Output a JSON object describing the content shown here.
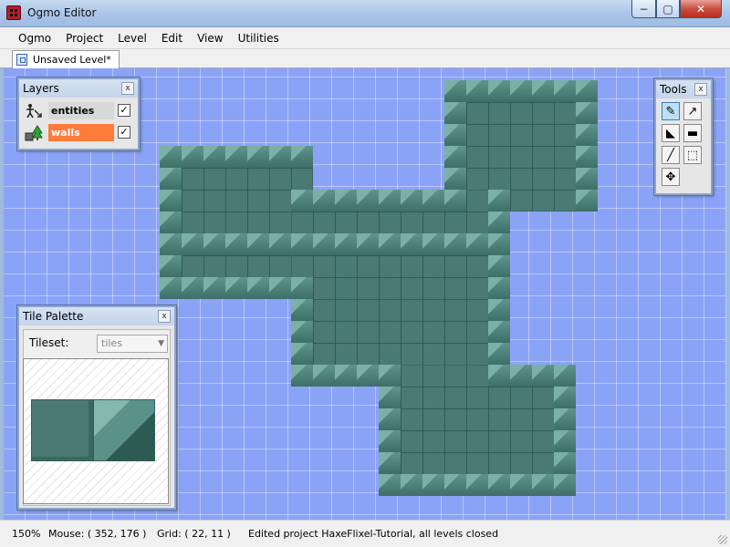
{
  "window": {
    "title": "Ogmo Editor",
    "minimize": "−",
    "maximize": "▢",
    "close": "✕"
  },
  "menu": {
    "items": [
      "Ogmo",
      "Project",
      "Level",
      "Edit",
      "View",
      "Utilities"
    ]
  },
  "tabs": [
    {
      "label": "Unsaved Level*"
    }
  ],
  "layers_panel": {
    "title": "Layers",
    "close": "x",
    "layers": [
      {
        "label": "entities",
        "checked": "✓",
        "icon": "entity-layer-icon",
        "highlight": "#d8d8d8"
      },
      {
        "label": "walls",
        "checked": "✓",
        "icon": "tile-layer-icon",
        "highlight": "#ff7b3a"
      }
    ]
  },
  "tools_panel": {
    "title": "Tools",
    "close": "x",
    "tools": [
      {
        "icon": "pencil-icon",
        "glyph": "✎",
        "active": true
      },
      {
        "icon": "eyedropper-icon",
        "glyph": "↗",
        "active": false
      },
      {
        "icon": "flood-fill-icon",
        "glyph": "◣",
        "active": false
      },
      {
        "icon": "rectangle-fill-icon",
        "glyph": "▬",
        "active": false
      },
      {
        "icon": "line-icon",
        "glyph": "╱",
        "active": false
      },
      {
        "icon": "select-rectangle-icon",
        "glyph": "⬚",
        "active": false
      },
      {
        "icon": "move-icon",
        "glyph": "✥",
        "active": false
      }
    ]
  },
  "palette_panel": {
    "title": "Tile Palette",
    "close": "x",
    "tileset_label": "Tileset:",
    "tileset_value": "tiles",
    "dropdown_icon": "▼"
  },
  "status": {
    "zoom": "150%",
    "mouse": "Mouse: ( 352, 176 )",
    "grid": "Grid: ( 22, 11 )",
    "message": "Edited project HaxeFlixel-Tutorial, all levels closed"
  },
  "colors": {
    "canvas": "#8ba3f7",
    "wall": "#4a7a73",
    "accent": "#ff7b3a"
  }
}
